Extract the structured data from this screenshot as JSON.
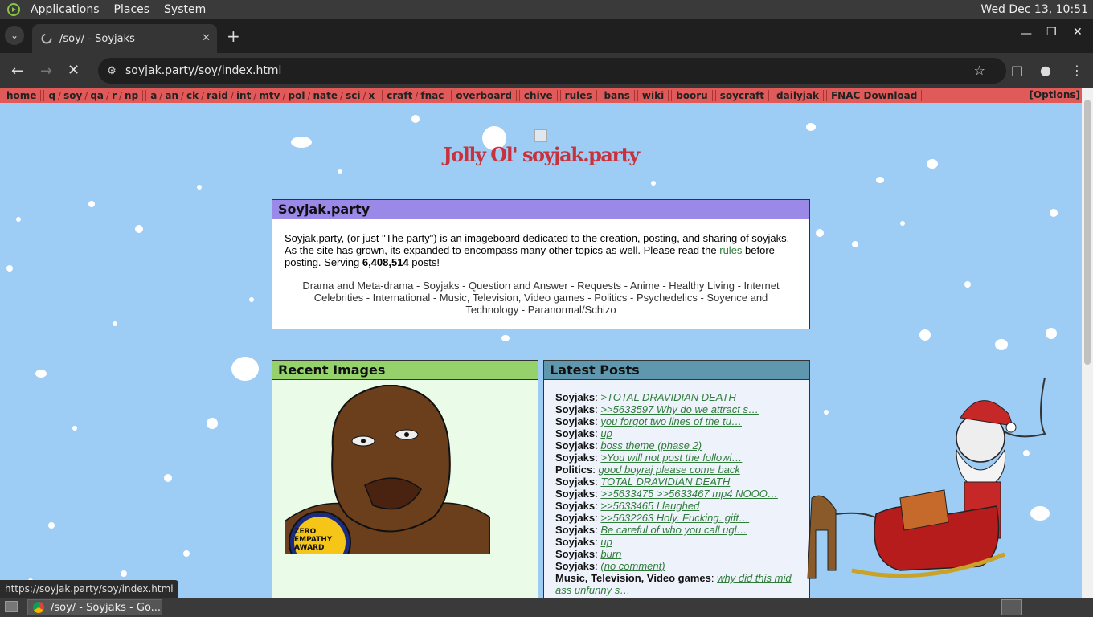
{
  "system_panel": {
    "menus": [
      "Applications",
      "Places",
      "System"
    ],
    "clock": "Wed Dec 13, 10:51"
  },
  "browser": {
    "tab_title": "/soy/ - Soyjaks",
    "url": "soyjak.party/soy/index.html",
    "status_url": "https://soyjak.party/soy/index.html"
  },
  "boardbar": {
    "groups": [
      [
        "home"
      ],
      [
        "q",
        "soy",
        "qa",
        "r",
        "np"
      ],
      [
        "a",
        "an",
        "ck",
        "raid",
        "int",
        "mtv",
        "pol",
        "nate",
        "sci",
        "x"
      ],
      [
        "craft",
        "fnac"
      ],
      [
        "overboard"
      ],
      [
        "chive"
      ],
      [
        "rules"
      ],
      [
        "bans"
      ],
      [
        "wiki"
      ],
      [
        "booru"
      ],
      [
        "soycraft"
      ],
      [
        "dailyjak"
      ],
      [
        "FNAC Download"
      ]
    ],
    "options": "[Options]"
  },
  "site_title": "Jolly Ol' soyjak.party",
  "about": {
    "header": "Soyjak.party",
    "text_1": "Soyjak.party, (or just \"The party\") is an imageboard dedicated to the creation, posting, and sharing of soyjaks. As the site has grown, its expanded to encompass many other topics as well. Please read the ",
    "rules_link": "rules",
    "text_2": " before posting. Serving ",
    "post_count": "6,408,514",
    "text_3": " posts!",
    "categories": "Drama and Meta-drama - Soyjaks - Question and Answer - Requests - Anime - Healthy Living - Internet Celebrities - International - Music, Television, Video games - Politics - Psychedelics - Soyence and Technology - Paranormal/Schizo"
  },
  "recent_images": {
    "header": "Recent Images",
    "badge_text": "ZERO EMPATHY AWARD"
  },
  "latest_posts": {
    "header": "Latest Posts",
    "posts": [
      {
        "board": "Soyjaks",
        "snippet": ">TOTAL DRAVIDIAN DEATH"
      },
      {
        "board": "Soyjaks",
        "snippet": ">>5633597 Why do we attract s…"
      },
      {
        "board": "Soyjaks",
        "snippet": "you forgot two lines of the tu…"
      },
      {
        "board": "Soyjaks",
        "snippet": "up"
      },
      {
        "board": "Soyjaks",
        "snippet": "boss theme (phase 2)"
      },
      {
        "board": "Soyjaks",
        "snippet": ">You will not post the followi…"
      },
      {
        "board": "Politics",
        "snippet": "good boyraj please come back"
      },
      {
        "board": "Soyjaks",
        "snippet": "TOTAL DRAVIDIAN DEATH"
      },
      {
        "board": "Soyjaks",
        "snippet": ">>5633475 >>5633467 mp4 NOOO…"
      },
      {
        "board": "Soyjaks",
        "snippet": ">>5633465 I laughed"
      },
      {
        "board": "Soyjaks",
        "snippet": ">>5632263 Holy. Fucking. gift…"
      },
      {
        "board": "Soyjaks",
        "snippet": "Be careful of who you call ugl…"
      },
      {
        "board": "Soyjaks",
        "snippet": "up"
      },
      {
        "board": "Soyjaks",
        "snippet": "burn"
      },
      {
        "board": "Soyjaks",
        "snippet": "(no comment)"
      },
      {
        "board": "Music, Television, Video games",
        "snippet": "why did this mid ass unfunny s…"
      }
    ]
  },
  "taskbar": {
    "task_label": "/soy/ - Soyjaks - Go..."
  }
}
